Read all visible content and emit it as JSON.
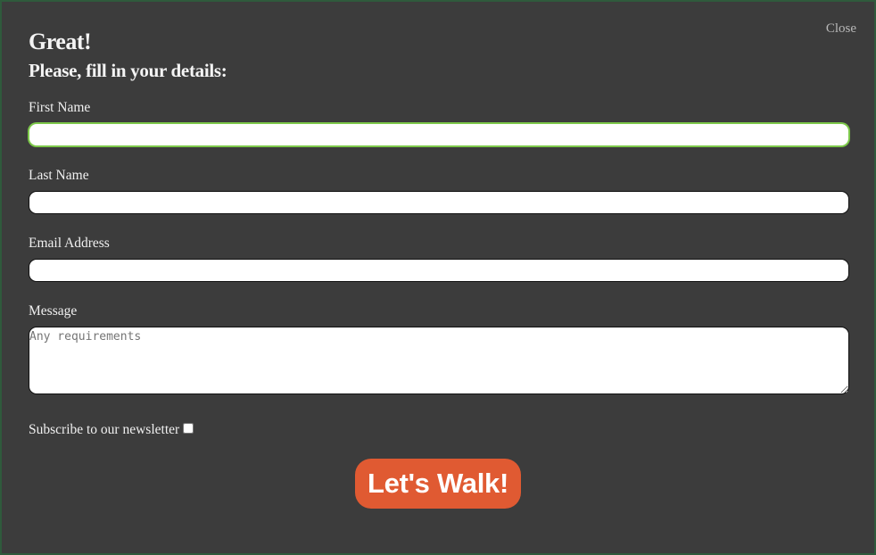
{
  "modal": {
    "close_label": "Close",
    "title": "Great!",
    "subtitle": "Please, fill in your details:"
  },
  "form": {
    "first_name": {
      "label": "First Name",
      "value": ""
    },
    "last_name": {
      "label": "Last Name",
      "value": ""
    },
    "email": {
      "label": "Email Address",
      "value": ""
    },
    "message": {
      "label": "Message",
      "value": "",
      "placeholder": "Any requirements"
    },
    "newsletter": {
      "label": "Subscribe to our newsletter",
      "checked": false
    },
    "submit_label": "Let's Walk!"
  },
  "colors": {
    "modal_background": "#3c3c3c",
    "submit_button": "#e05a32",
    "focus_ring": "#7dc84a"
  }
}
